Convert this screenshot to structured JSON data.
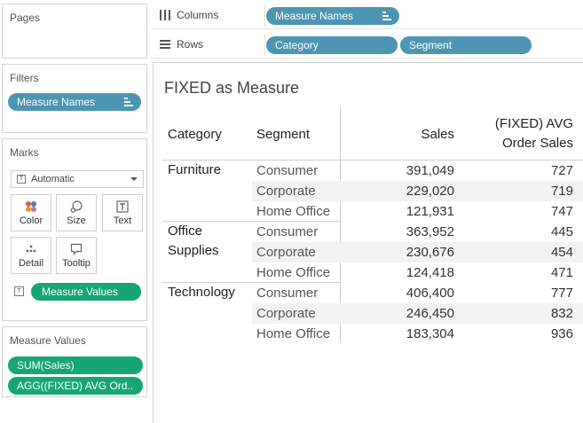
{
  "pages": {
    "title": "Pages"
  },
  "filters": {
    "title": "Filters",
    "pill": "Measure Names"
  },
  "marks": {
    "title": "Marks",
    "type": "Automatic",
    "buttons": {
      "color": "Color",
      "size": "Size",
      "text": "Text",
      "detail": "Detail",
      "tooltip": "Tooltip"
    },
    "text_pill": "Measure Values"
  },
  "measure_values": {
    "title": "Measure Values",
    "items": [
      "SUM(Sales)",
      "AGG((FIXED) AVG Ord.."
    ]
  },
  "columns": {
    "label": "Columns",
    "pill": "Measure Names"
  },
  "rows": {
    "label": "Rows",
    "pills": [
      "Category",
      "Segment"
    ]
  },
  "view": {
    "title": "FIXED as Measure",
    "headers": {
      "category": "Category",
      "segment": "Segment",
      "sales": "Sales",
      "avg_line1": "(FIXED) AVG",
      "avg_line2": "Order Sales"
    },
    "rows": [
      {
        "segment": "Consumer",
        "sales": "391,049",
        "avg": "727"
      },
      {
        "segment": "Corporate",
        "sales": "229,020",
        "avg": "719"
      },
      {
        "segment": "Home Office",
        "sales": "121,931",
        "avg": "747"
      },
      {
        "segment": "Consumer",
        "sales": "363,952",
        "avg": "445"
      },
      {
        "segment": "Corporate",
        "sales": "230,676",
        "avg": "454"
      },
      {
        "segment": "Home Office",
        "sales": "124,418",
        "avg": "471"
      },
      {
        "segment": "Consumer",
        "sales": "406,400",
        "avg": "777"
      },
      {
        "segment": "Corporate",
        "sales": "246,450",
        "avg": "832"
      },
      {
        "segment": "Home Office",
        "sales": "183,304",
        "avg": "936"
      }
    ],
    "categories": [
      {
        "line1": "Furniture",
        "line2": ""
      },
      {
        "line1": "Office",
        "line2": "Supplies"
      },
      {
        "line1": "Technology",
        "line2": ""
      }
    ]
  },
  "colors": {
    "blue_pill": "#4c96b3",
    "green_pill": "#17a673",
    "band": "#f2f2f2"
  }
}
